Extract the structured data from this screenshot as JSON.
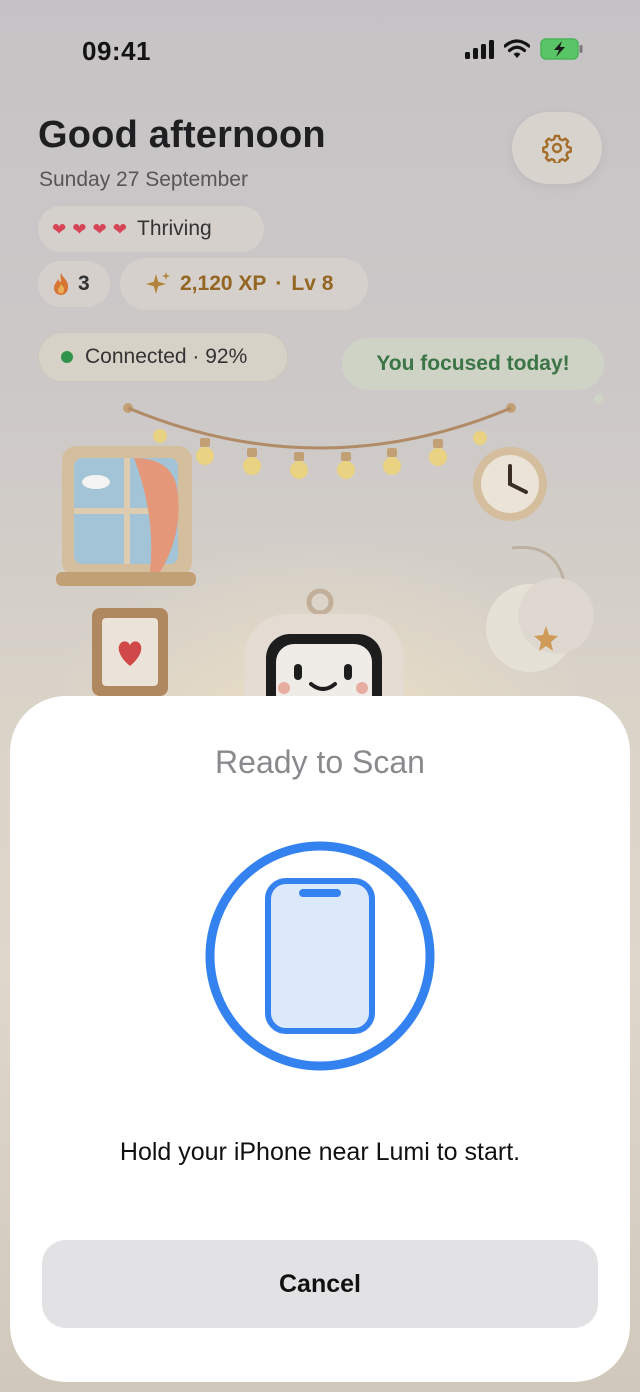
{
  "status_bar": {
    "time": "09:41"
  },
  "header": {
    "greeting": "Good afternoon",
    "date": "Sunday 27 September",
    "settings_icon": "gear-icon"
  },
  "mood": {
    "hearts": 4,
    "label": "Thriving"
  },
  "streak": {
    "count": "3",
    "icon": "flame-icon"
  },
  "xp": {
    "text": "2,120 XP",
    "separator": "·",
    "level": "Lv 8",
    "icon": "sparkle-icon"
  },
  "connection": {
    "text": "Connected · 92%",
    "status_color": "#2f9a4d"
  },
  "speech_bubble": {
    "text": "You focused today!"
  },
  "scan_sheet": {
    "title": "Ready to Scan",
    "message": "Hold your iPhone near Lumi to start.",
    "cancel_label": "Cancel",
    "icon": "phone-scan-icon",
    "accent_color": "#3482f0"
  }
}
